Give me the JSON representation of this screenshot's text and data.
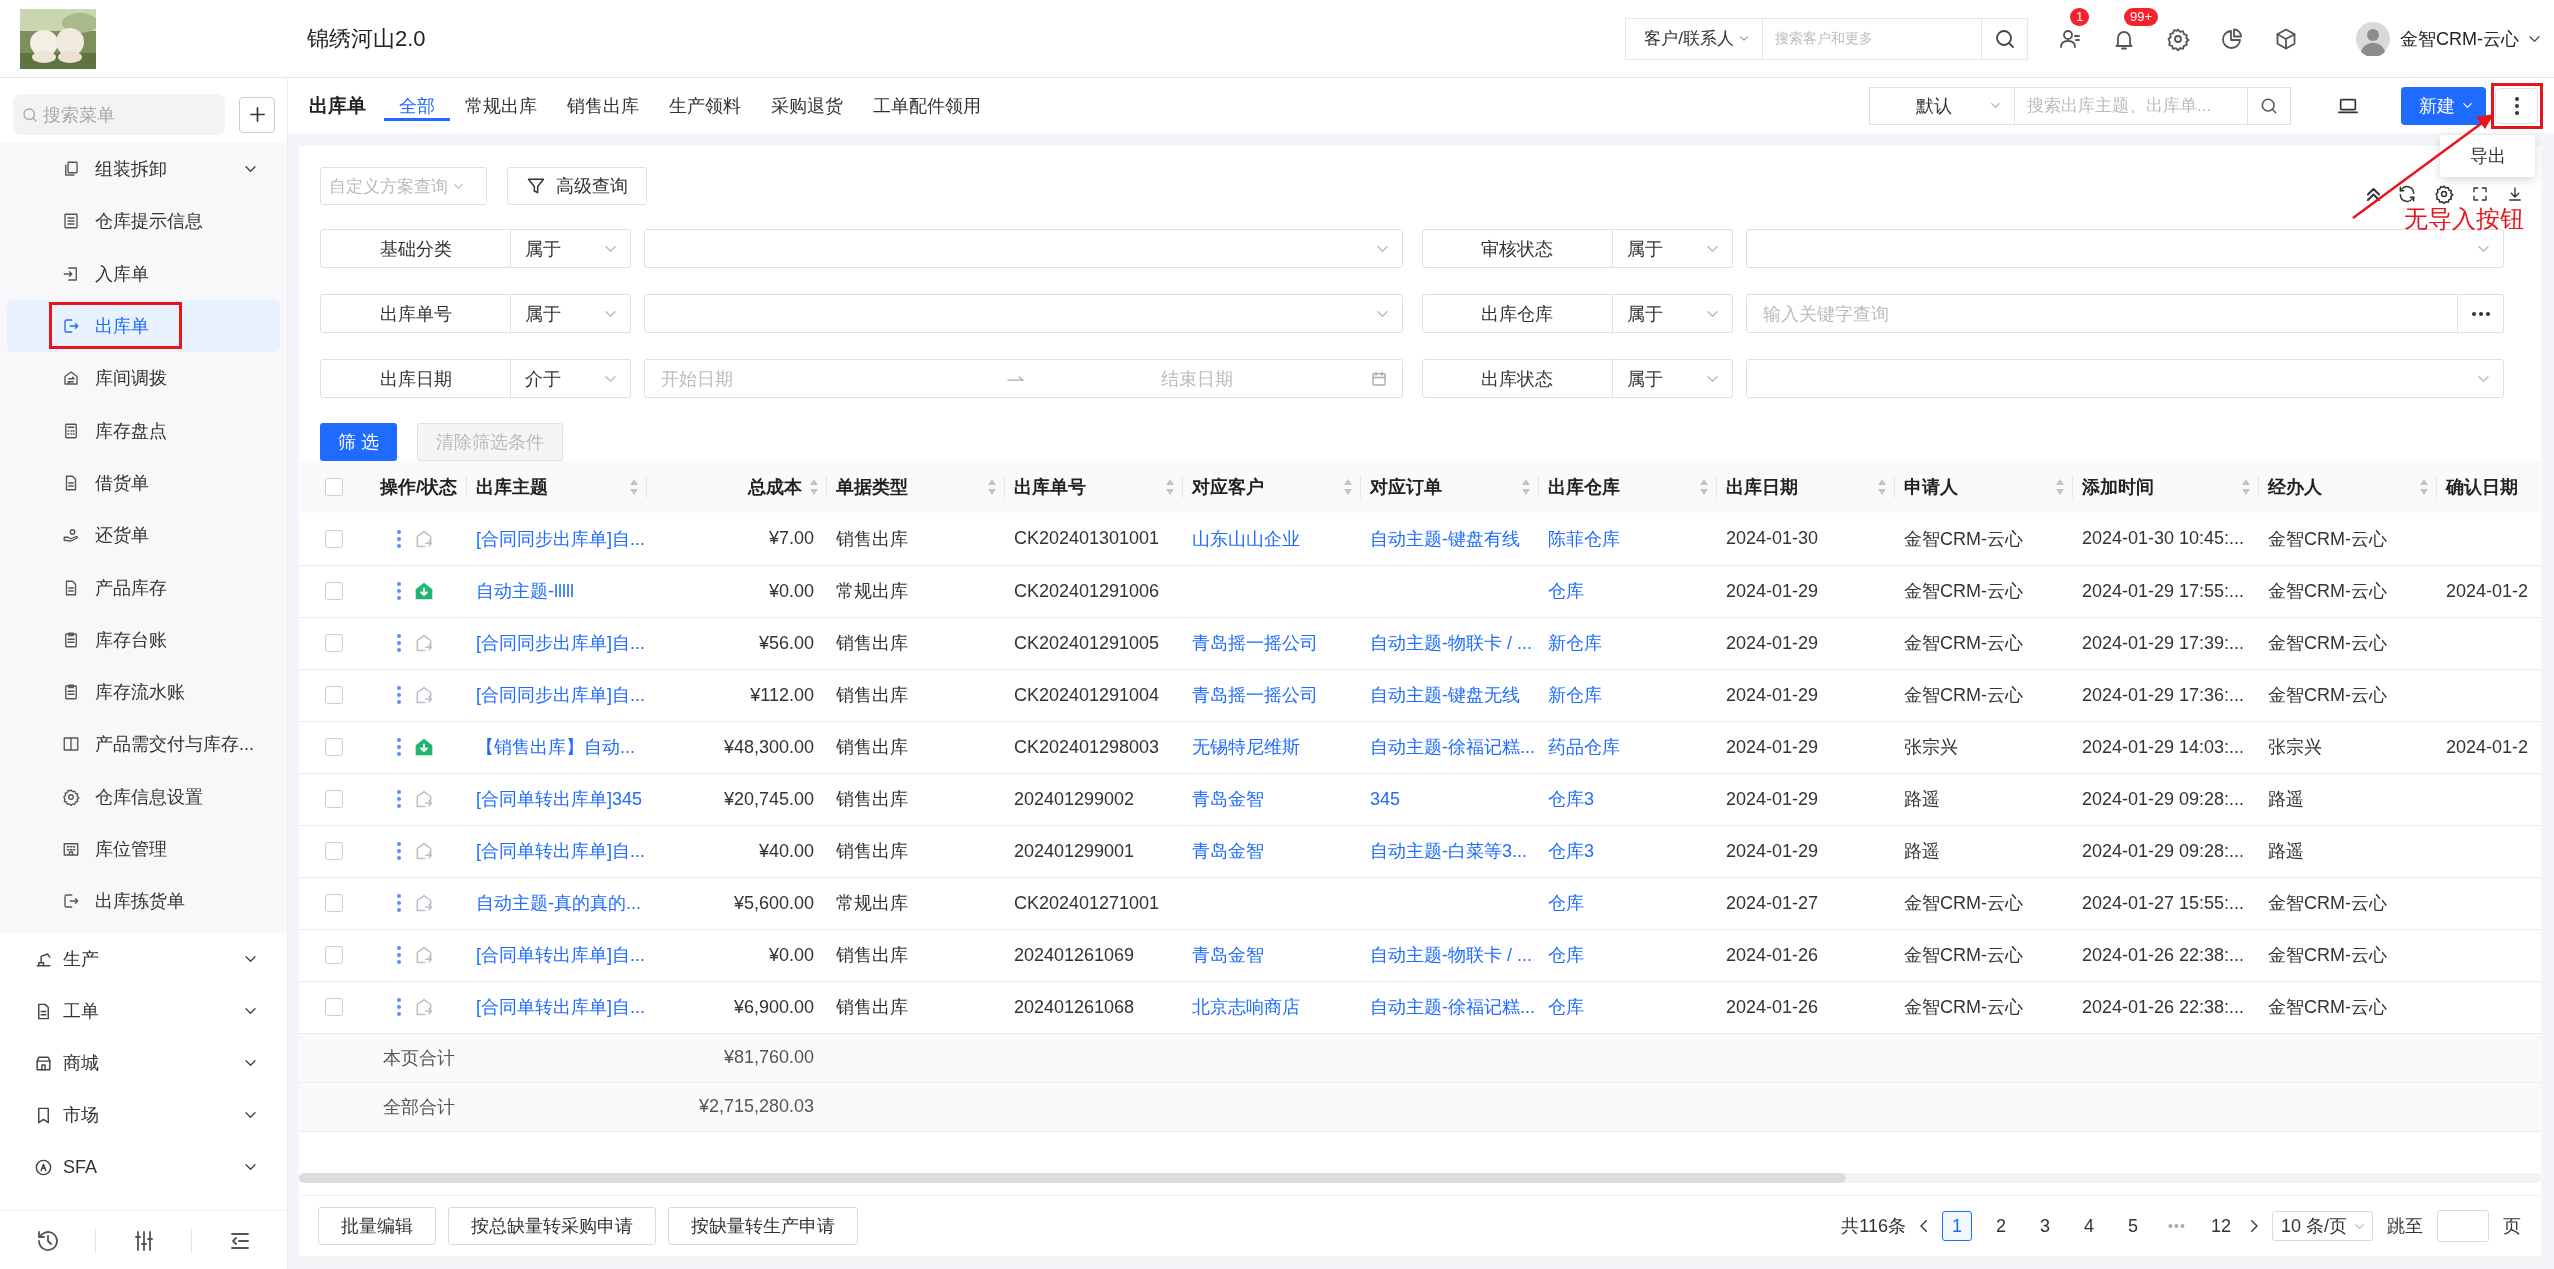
{
  "header": {
    "title": "锦绣河山2.0",
    "search_scope": "客户/联系人",
    "search_placeholder": "搜索客户和更多",
    "badges": [
      "1",
      "99+"
    ],
    "user": "金智CRM-云心"
  },
  "sidebar": {
    "search_placeholder": "搜索菜单",
    "items": [
      {
        "label": "组装拆卸",
        "kind": "group",
        "selected": false
      },
      {
        "label": "仓库提示信息",
        "kind": "page",
        "selected": false
      },
      {
        "label": "入库单",
        "kind": "page",
        "selected": false
      },
      {
        "label": "出库单",
        "kind": "page",
        "selected": true
      },
      {
        "label": "库间调拨",
        "kind": "page",
        "selected": false
      },
      {
        "label": "库存盘点",
        "kind": "page",
        "selected": false
      },
      {
        "label": "借货单",
        "kind": "page",
        "selected": false
      },
      {
        "label": "还货单",
        "kind": "page",
        "selected": false
      },
      {
        "label": "产品库存",
        "kind": "page",
        "selected": false
      },
      {
        "label": "库存台账",
        "kind": "page",
        "selected": false
      },
      {
        "label": "库存流水账",
        "kind": "page",
        "selected": false
      },
      {
        "label": "产品需交付与库存...",
        "kind": "page",
        "selected": false
      },
      {
        "label": "仓库信息设置",
        "kind": "page",
        "selected": false
      },
      {
        "label": "库位管理",
        "kind": "page",
        "selected": false
      },
      {
        "label": "出库拣货单",
        "kind": "page",
        "selected": false
      }
    ],
    "sections": [
      {
        "label": "生产"
      },
      {
        "label": "工单"
      },
      {
        "label": "商城"
      },
      {
        "label": "市场"
      },
      {
        "label": "SFA"
      }
    ]
  },
  "page": {
    "title": "出库单",
    "tabs": [
      {
        "label": "全部",
        "selected": true
      },
      {
        "label": "常规出库",
        "selected": false
      },
      {
        "label": "销售出库",
        "selected": false
      },
      {
        "label": "生产领料",
        "selected": false
      },
      {
        "label": "采购退货",
        "selected": false
      },
      {
        "label": "工单配件领用",
        "selected": false
      }
    ],
    "view": "默认",
    "search_placeholder": "搜索出库主题、出库单...",
    "new_button": "新建",
    "menu": [
      "导出"
    ]
  },
  "annotation": {
    "text": "无导入按钮"
  },
  "filters": {
    "scheme_placeholder": "自定义方案查询",
    "advanced": "高级查询",
    "rows": [
      {
        "field": "基础分类",
        "operator": "属于",
        "kind": "select"
      },
      {
        "field": "审核状态",
        "operator": "属于",
        "kind": "select"
      },
      {
        "field": "出库单号",
        "operator": "属于",
        "kind": "select"
      },
      {
        "field": "出库仓库",
        "operator": "属于",
        "kind": "keyword",
        "placeholder": "输入关键字查询"
      },
      {
        "field": "出库日期",
        "operator": "介于",
        "kind": "daterange",
        "start_placeholder": "开始日期",
        "end_placeholder": "结束日期"
      },
      {
        "field": "出库状态",
        "operator": "属于",
        "kind": "select"
      }
    ],
    "apply": "筛 选",
    "clear": {
      "label": "清除筛选条件",
      "disabled": true
    }
  },
  "table": {
    "select_all": {
      "checked": false
    },
    "action_column": {
      "label": "操作/状态"
    },
    "columns": [
      {
        "label": "出库主题",
        "kind": "link",
        "sortable": true
      },
      {
        "label": "总成本",
        "kind": "money",
        "sortable": true
      },
      {
        "label": "单据类型",
        "kind": "text",
        "sortable": true
      },
      {
        "label": "出库单号",
        "kind": "text",
        "sortable": true
      },
      {
        "label": "对应客户",
        "kind": "link",
        "sortable": true
      },
      {
        "label": "对应订单",
        "kind": "link",
        "sortable": true
      },
      {
        "label": "出库仓库",
        "kind": "link",
        "sortable": true
      },
      {
        "label": "出库日期",
        "kind": "text",
        "sortable": true
      },
      {
        "label": "申请人",
        "kind": "text",
        "sortable": true
      },
      {
        "label": "添加时间",
        "kind": "text",
        "sortable": true
      },
      {
        "label": "经办人",
        "kind": "text",
        "sortable": true
      },
      {
        "label": "确认日期",
        "kind": "text",
        "sortable": false
      }
    ],
    "rows": [
      {
        "checked": false,
        "kind": "pending",
        "cells": [
          "[合同同步出库单]自...",
          "¥7.00",
          "销售出库",
          "CK202401301001",
          "山东山山企业",
          "自动主题-键盘有线",
          "陈菲仓库",
          "2024-01-30",
          "金智CRM-云心",
          "2024-01-30 10:45:...",
          "金智CRM-云心",
          null
        ]
      },
      {
        "checked": false,
        "kind": "done",
        "cells": [
          "自动主题-lllll",
          "¥0.00",
          "常规出库",
          "CK202401291006",
          null,
          null,
          "仓库",
          "2024-01-29",
          "金智CRM-云心",
          "2024-01-29 17:55:...",
          "金智CRM-云心",
          "2024-01-2"
        ]
      },
      {
        "checked": false,
        "kind": "pending",
        "cells": [
          "[合同同步出库单]自...",
          "¥56.00",
          "销售出库",
          "CK202401291005",
          "青岛摇一摇公司",
          "自动主题-物联卡 / ...",
          "新仓库",
          "2024-01-29",
          "金智CRM-云心",
          "2024-01-29 17:39:...",
          "金智CRM-云心",
          null
        ]
      },
      {
        "checked": false,
        "kind": "pending",
        "cells": [
          "[合同同步出库单]自...",
          "¥112.00",
          "销售出库",
          "CK202401291004",
          "青岛摇一摇公司",
          "自动主题-键盘无线",
          "新仓库",
          "2024-01-29",
          "金智CRM-云心",
          "2024-01-29 17:36:...",
          "金智CRM-云心",
          null
        ]
      },
      {
        "checked": false,
        "kind": "done",
        "cells": [
          "【销售出库】自动...",
          "¥48,300.00",
          "销售出库",
          "CK202401298003",
          "无锡特尼维斯",
          "自动主题-徐福记糕...",
          "药品仓库",
          "2024-01-29",
          "张宗兴",
          "2024-01-29 14:03:...",
          "张宗兴",
          "2024-01-2"
        ]
      },
      {
        "checked": false,
        "kind": "pending",
        "cells": [
          "[合同单转出库单]345",
          "¥20,745.00",
          "销售出库",
          "202401299002",
          "青岛金智",
          "345",
          "仓库3",
          "2024-01-29",
          "路遥",
          "2024-01-29 09:28:...",
          "路遥",
          null
        ]
      },
      {
        "checked": false,
        "kind": "pending",
        "cells": [
          "[合同单转出库单]自...",
          "¥40.00",
          "销售出库",
          "202401299001",
          "青岛金智",
          "自动主题-白菜等3...",
          "仓库3",
          "2024-01-29",
          "路遥",
          "2024-01-29 09:28:...",
          "路遥",
          null
        ]
      },
      {
        "checked": false,
        "kind": "pending",
        "cells": [
          "自动主题-真的真的...",
          "¥5,600.00",
          "常规出库",
          "CK202401271001",
          null,
          null,
          "仓库",
          "2024-01-27",
          "金智CRM-云心",
          "2024-01-27 15:55:...",
          "金智CRM-云心",
          null
        ]
      },
      {
        "checked": false,
        "kind": "pending",
        "cells": [
          "[合同单转出库单]自...",
          "¥0.00",
          "销售出库",
          "202401261069",
          "青岛金智",
          "自动主题-物联卡 / ...",
          "仓库",
          "2024-01-26",
          "金智CRM-云心",
          "2024-01-26 22:38:...",
          "金智CRM-云心",
          null
        ]
      },
      {
        "checked": false,
        "kind": "pending",
        "cells": [
          "[合同单转出库单]自...",
          "¥6,900.00",
          "销售出库",
          "202401261068",
          "北京志响商店",
          "自动主题-徐福记糕...",
          "仓库",
          "2024-01-26",
          "金智CRM-云心",
          "2024-01-26 22:38:...",
          "金智CRM-云心",
          null
        ]
      }
    ],
    "totals": [
      {
        "label": "本页合计",
        "value": "¥81,760.00"
      },
      {
        "label": "全部合计",
        "value": "¥2,715,280.03"
      }
    ]
  },
  "bulk_actions": [
    "批量编辑",
    "按总缺量转采购申请",
    "按缺量转生产申请"
  ],
  "pagination": {
    "total": "共116条",
    "pages": [
      {
        "label": "1",
        "kind": "page",
        "selected": true
      },
      {
        "label": "2",
        "kind": "page",
        "selected": false
      },
      {
        "label": "3",
        "kind": "page",
        "selected": false
      },
      {
        "label": "4",
        "kind": "page",
        "selected": false
      },
      {
        "label": "5",
        "kind": "page",
        "selected": false
      },
      {
        "label": "•••",
        "kind": "ellipsis"
      },
      {
        "label": "12",
        "kind": "page",
        "selected": false
      }
    ],
    "page_size": "10 条/页",
    "jump_label": "跳至",
    "page_unit": "页"
  }
}
